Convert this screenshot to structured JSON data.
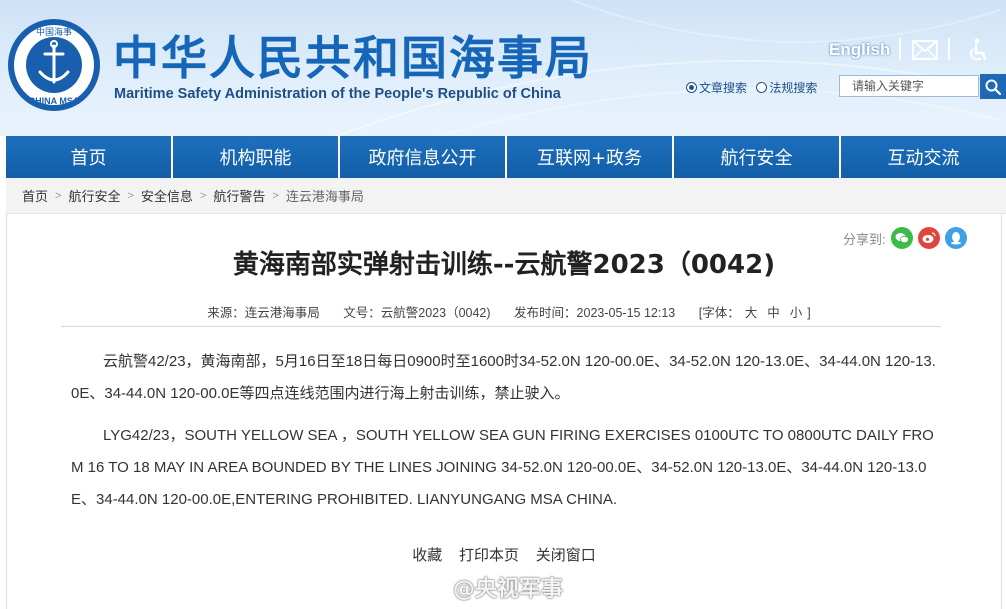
{
  "header": {
    "title_cn": "中华人民共和国海事局",
    "title_en": "Maritime Safety Administration of the People's Republic of China",
    "logo_text_top": "中国海事",
    "logo_text_bottom": "CHINA MSA",
    "english_link": "English",
    "mail_icon": "mail-icon",
    "accessibility_icon": "accessibility-icon"
  },
  "search": {
    "options": [
      {
        "label": "文章搜索",
        "checked": true
      },
      {
        "label": "法规搜索",
        "checked": false
      }
    ],
    "placeholder": "请输入关键字",
    "button_icon": "search-icon"
  },
  "nav": {
    "items": [
      "首页",
      "机构职能",
      "政府信息公开",
      "互联网+政务",
      "航行安全",
      "互动交流"
    ]
  },
  "breadcrumb": {
    "items": [
      "首页",
      "航行安全",
      "安全信息",
      "航行警告",
      "连云港海事局"
    ]
  },
  "share": {
    "label": "分享到:",
    "buttons": [
      {
        "name": "wechat-icon",
        "color": "#3dbb4a"
      },
      {
        "name": "weibo-icon",
        "color": "#e0453c"
      },
      {
        "name": "qq-icon",
        "color": "#3fa0e6"
      }
    ]
  },
  "article": {
    "title": "黄海南部实弹射击训练--云航警2023（0042)",
    "source_label": "来源：",
    "source": "连云港海事局",
    "doc_no_label": "文号：",
    "doc_no": "云航警2023（0042)",
    "date_label": "发布时间：",
    "date": "2023-05-15 12:13",
    "font_label": "[字体：",
    "font_sizes": [
      "大",
      "中",
      "小"
    ],
    "font_close": "]",
    "paragraphs": [
      "云航警42/23，黄海南部，5月16日至18日每日0900时至1600时34-52.0N 120-00.0E、34-52.0N 120-13.0E、34-44.0N 120-13.0E、34-44.0N 120-00.0E等四点连线范围内进行海上射击训练，禁止驶入。",
      "LYG42/23，SOUTH YELLOW SEA ，SOUTH YELLOW SEA GUN FIRING EXERCISES 0100UTC TO 0800UTC DAILY FROM 16 TO 18 MAY IN AREA BOUNDED BY THE LINES JOINING 34-52.0N 120-00.0E、34-52.0N 120-13.0E、34-44.0N 120-13.0E、34-44.0N 120-00.0E,ENTERING PROHIBITED. LIANYUNGANG MSA CHINA."
    ],
    "actions": [
      "收藏",
      "打印本页",
      "关闭窗口"
    ]
  },
  "watermark": {
    "text": "@央视军事"
  },
  "colors": {
    "brand_blue": "#1565b8",
    "nav_blue": "#1563ad"
  }
}
